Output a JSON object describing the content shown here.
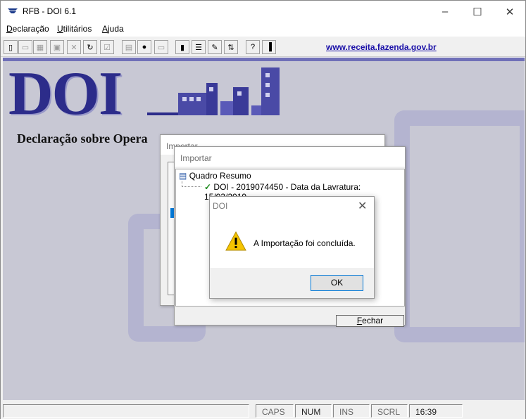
{
  "window": {
    "title": "RFB - DOI 6.1",
    "minimize": "–",
    "maximize": "☐",
    "close": "✕"
  },
  "menu": [
    {
      "label": "Declaração",
      "hot": "D",
      "rest": "eclaração"
    },
    {
      "label": "Utilitários",
      "hot": "U",
      "rest": "tilitários"
    },
    {
      "label": "Ajuda",
      "hot": "A",
      "rest": "juda"
    }
  ],
  "toolbar": {
    "link": "www.receita.fazenda.gov.br"
  },
  "desktop": {
    "logo_text": "DOI",
    "subtitle": "Declaração sobre Opera"
  },
  "dialog_back": {
    "title": "Importar"
  },
  "dialog_front": {
    "title": "Importar",
    "tree_root": "Quadro Resumo",
    "tree_child": "DOI - 2019074450 - Data da Lavratura: 15/03/2019",
    "close_button": "Fechar",
    "close_button_hot": "F",
    "close_button_rest": "echar"
  },
  "message": {
    "title": "DOI",
    "text": "A Importação foi concluída.",
    "ok": "OK"
  },
  "status": {
    "caps": "CAPS",
    "num": "NUM",
    "ins": "INS",
    "scrl": "SCRL",
    "time": "16:39"
  },
  "colors": {
    "link": "#1a10a8",
    "logo": "#2c2c8a",
    "desktop": "#c8c8d4"
  }
}
